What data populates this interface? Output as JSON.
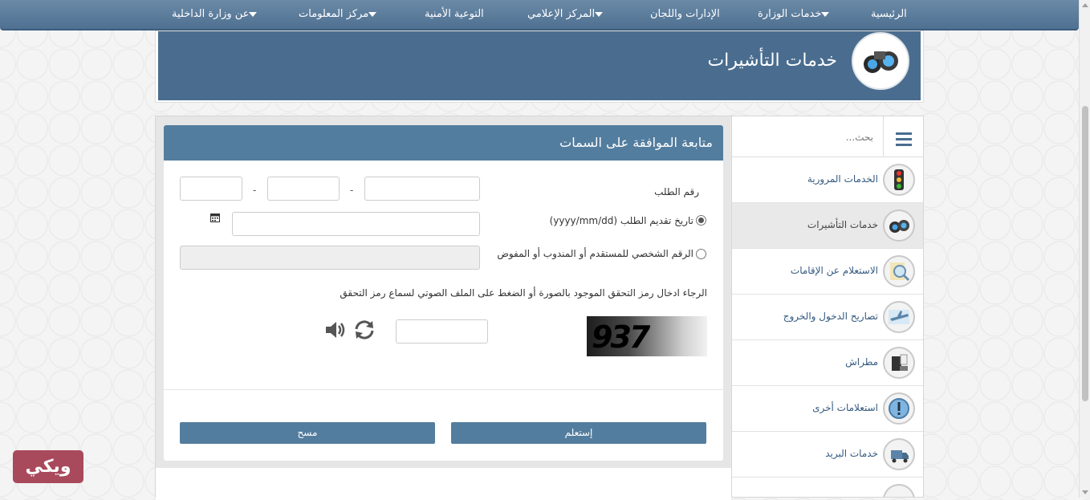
{
  "nav": {
    "items": [
      {
        "label": "الرئيسية",
        "dropdown": false
      },
      {
        "label": "خدمات الوزارة",
        "dropdown": true
      },
      {
        "label": "الإدارات واللجان",
        "dropdown": false
      },
      {
        "label": "المركز الإعلامي",
        "dropdown": true
      },
      {
        "label": "التوعية الأمنية",
        "dropdown": false
      },
      {
        "label": "مركز المعلومات",
        "dropdown": true
      },
      {
        "label": "عن وزارة الداخلية",
        "dropdown": true
      }
    ]
  },
  "banner": {
    "title": "خدمات التأشيرات",
    "icon": "binoculars-icon"
  },
  "sidebar": {
    "search_placeholder": "بحث...",
    "items": [
      {
        "label": "الخدمات المرورية",
        "icon": "traffic-light-icon",
        "active": false
      },
      {
        "label": "خدمات التأشيرات",
        "icon": "binoculars-icon",
        "active": true
      },
      {
        "label": "الاستعلام عن الإقامات",
        "icon": "magnifier-icon",
        "active": false
      },
      {
        "label": "تصاريح الدخول والخروج",
        "icon": "airplane-icon",
        "active": false
      },
      {
        "label": "مطراش",
        "icon": "fax-machine-icon",
        "active": false
      },
      {
        "label": "استعلامات أخرى",
        "icon": "exclamation-icon",
        "active": false
      },
      {
        "label": "خدمات البريد",
        "icon": "delivery-truck-icon",
        "active": false
      }
    ]
  },
  "form": {
    "title": "متابعة الموافقة على السمات",
    "request_number_label": "رقم الطلب",
    "separator": "-",
    "date_option_label": "تاريخ تقديم الطلب (yyyy/mm/dd)",
    "id_option_label": "الرقم الشخصي للمستقدم أو المندوب أو المفوض",
    "captcha_instruction": "الرجاء ادخال رمز التحقق الموجود بالصورة أو الضغط على الملف الصوتي لسماع رمز التحقق",
    "captcha_text": "937",
    "submit_label": "إستعلم",
    "clear_label": "مسح"
  },
  "colors": {
    "nav": "#5a7b9b",
    "header": "#4a6d8f",
    "button": "#537d9e"
  },
  "watermark": {
    "text": "ويكي"
  }
}
